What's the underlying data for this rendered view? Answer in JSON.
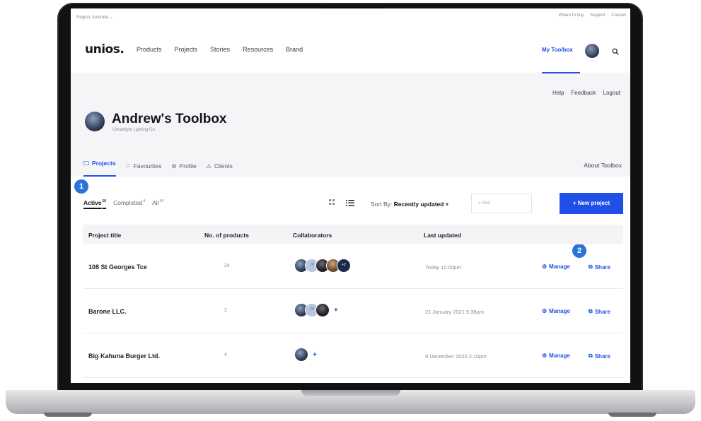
{
  "topbar": {
    "region": "Region: Australia",
    "links": [
      "Where to buy",
      "Support",
      "Contact"
    ]
  },
  "nav": {
    "logo": "unios.",
    "menu": [
      "Products",
      "Projects",
      "Stories",
      "Resources",
      "Brand"
    ],
    "toolbox_label": "My Toolbox"
  },
  "header": {
    "links": [
      "Help",
      "Feedback",
      "Logout"
    ],
    "title": "Andrew's Toolbox",
    "subtitle": "Ultrabright Lighting Co.",
    "tabs": [
      "Projects",
      "Favourites",
      "Profile",
      "Clients"
    ],
    "about": "About Toolbox"
  },
  "badges": [
    "1",
    "2"
  ],
  "filters": {
    "items": [
      {
        "label": "Active",
        "count": "10"
      },
      {
        "label": "Completed",
        "count": "4"
      },
      {
        "label": "All",
        "count": "14"
      }
    ],
    "sort_prefix": "Sort By:",
    "sort_value": "Recently updated",
    "find_placeholder": "Find",
    "new_project": "+ New project"
  },
  "table": {
    "headers": [
      "Project title",
      "No. of products",
      "Collaborators",
      "Last updated"
    ],
    "rows": [
      {
        "title": "108 St Georges Tce",
        "products": "24",
        "updated": "Today 11:00pm",
        "collab_more": "+2"
      },
      {
        "title": "Barone LLC.",
        "products": "2",
        "updated": "21 January 2021 5:38pm",
        "collab_more": "+"
      },
      {
        "title": "Big Kahuna Burger Ltd.",
        "products": "4",
        "updated": "9 December 2020 2:10pm",
        "collab_more": "+"
      }
    ],
    "initials": "JV",
    "manage_label": "Manage",
    "share_label": "Share"
  },
  "colors": {
    "accent": "#2051e8",
    "badge": "#2a74d8",
    "header_bg": "#f5f5f7"
  }
}
